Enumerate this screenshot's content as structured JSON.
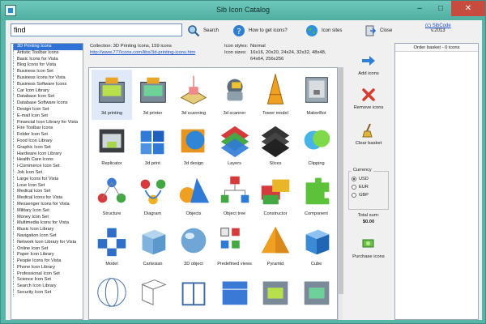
{
  "window": {
    "title": "Sib Icon Catalog",
    "min": "–",
    "max": "□",
    "close": "✕"
  },
  "toolbar": {
    "search_value": "find",
    "search_label": "Search",
    "howto_label": "How to get icons?",
    "sites_label": "Icon sites",
    "close_label": "Close",
    "copyright": "(c) SibCode",
    "version": "v.2013"
  },
  "categories": [
    "3D Printing Icons",
    "Artistic Toolbar Icons",
    "Basic Icons for Vista",
    "Blog Icons for Vista",
    "Business Icon Set",
    "Business Icons for Vista",
    "Business Software Icons",
    "Car Icon Library",
    "Database Icon Set",
    "Database Software Icons",
    "Design Icon Set",
    "E-mail Icon Set",
    "Financial Icon Library for Vista",
    "Fire Toolbar Icons",
    "Folder Icon Set",
    "Food Icon Library",
    "Graphic Icon Set",
    "Hardware Icon Library",
    "Health Care Icons",
    "i-Commerce Icon Set",
    "Job Icon Set",
    "Large Icons for Vista",
    "Love Icon Set",
    "Medical Icon Set",
    "Medical Icons for Vista",
    "Messenger Icons for Vista",
    "Military Icon Set",
    "Money Icon Set",
    "Multimedia Icons for Vista",
    "Music Icon Library",
    "Navigation Icon Set",
    "Network Icon Library for Vista",
    "Online Icon Set",
    "Paper Icon Library",
    "People Icons for Vista",
    "Phone Icon Library",
    "Professional Icon Set",
    "Science Icon Set",
    "Search Icon Library",
    "Security Icon Set"
  ],
  "info": {
    "collection": "Collection: 3D Printing Icons, 159 icons",
    "url": "http://www.777icons.com/libs/3d-printing-icons.htm",
    "styles_label": "Icon styles:",
    "styles_value": "Normal",
    "sizes_label": "Icon sizes:",
    "sizes_value": "16x16, 20x20, 24x24, 32x32, 48x48, 64x64, 256x256"
  },
  "icons": [
    {
      "label": "3d printing"
    },
    {
      "label": "3d printer"
    },
    {
      "label": "3d scanning"
    },
    {
      "label": "3d scanner"
    },
    {
      "label": "Tower model"
    },
    {
      "label": "MakerBot"
    },
    {
      "label": "Replicator"
    },
    {
      "label": "3d print"
    },
    {
      "label": "3d design"
    },
    {
      "label": "Layers"
    },
    {
      "label": "Slices"
    },
    {
      "label": "Clipping"
    },
    {
      "label": "Structure"
    },
    {
      "label": "Diagram"
    },
    {
      "label": "Objects"
    },
    {
      "label": "Object tree"
    },
    {
      "label": "Constructor"
    },
    {
      "label": "Component"
    },
    {
      "label": "Model"
    },
    {
      "label": "Cartesian"
    },
    {
      "label": "3D object"
    },
    {
      "label": "Predefined views"
    },
    {
      "label": "Pyramid"
    },
    {
      "label": "Cube"
    },
    {
      "label": ""
    },
    {
      "label": ""
    },
    {
      "label": ""
    },
    {
      "label": ""
    },
    {
      "label": ""
    },
    {
      "label": ""
    }
  ],
  "actions": {
    "add": "Add icons",
    "remove": "Remove icons",
    "clear": "Clear basket",
    "purchase": "Purchase icons"
  },
  "currency": {
    "legend": "Currency",
    "options": [
      "USD",
      "EUR",
      "GBP"
    ],
    "selected": "USD"
  },
  "total": {
    "label": "Total sum:",
    "amount": "$0.00"
  },
  "basket": {
    "header": "Order basket - 0 icons"
  }
}
